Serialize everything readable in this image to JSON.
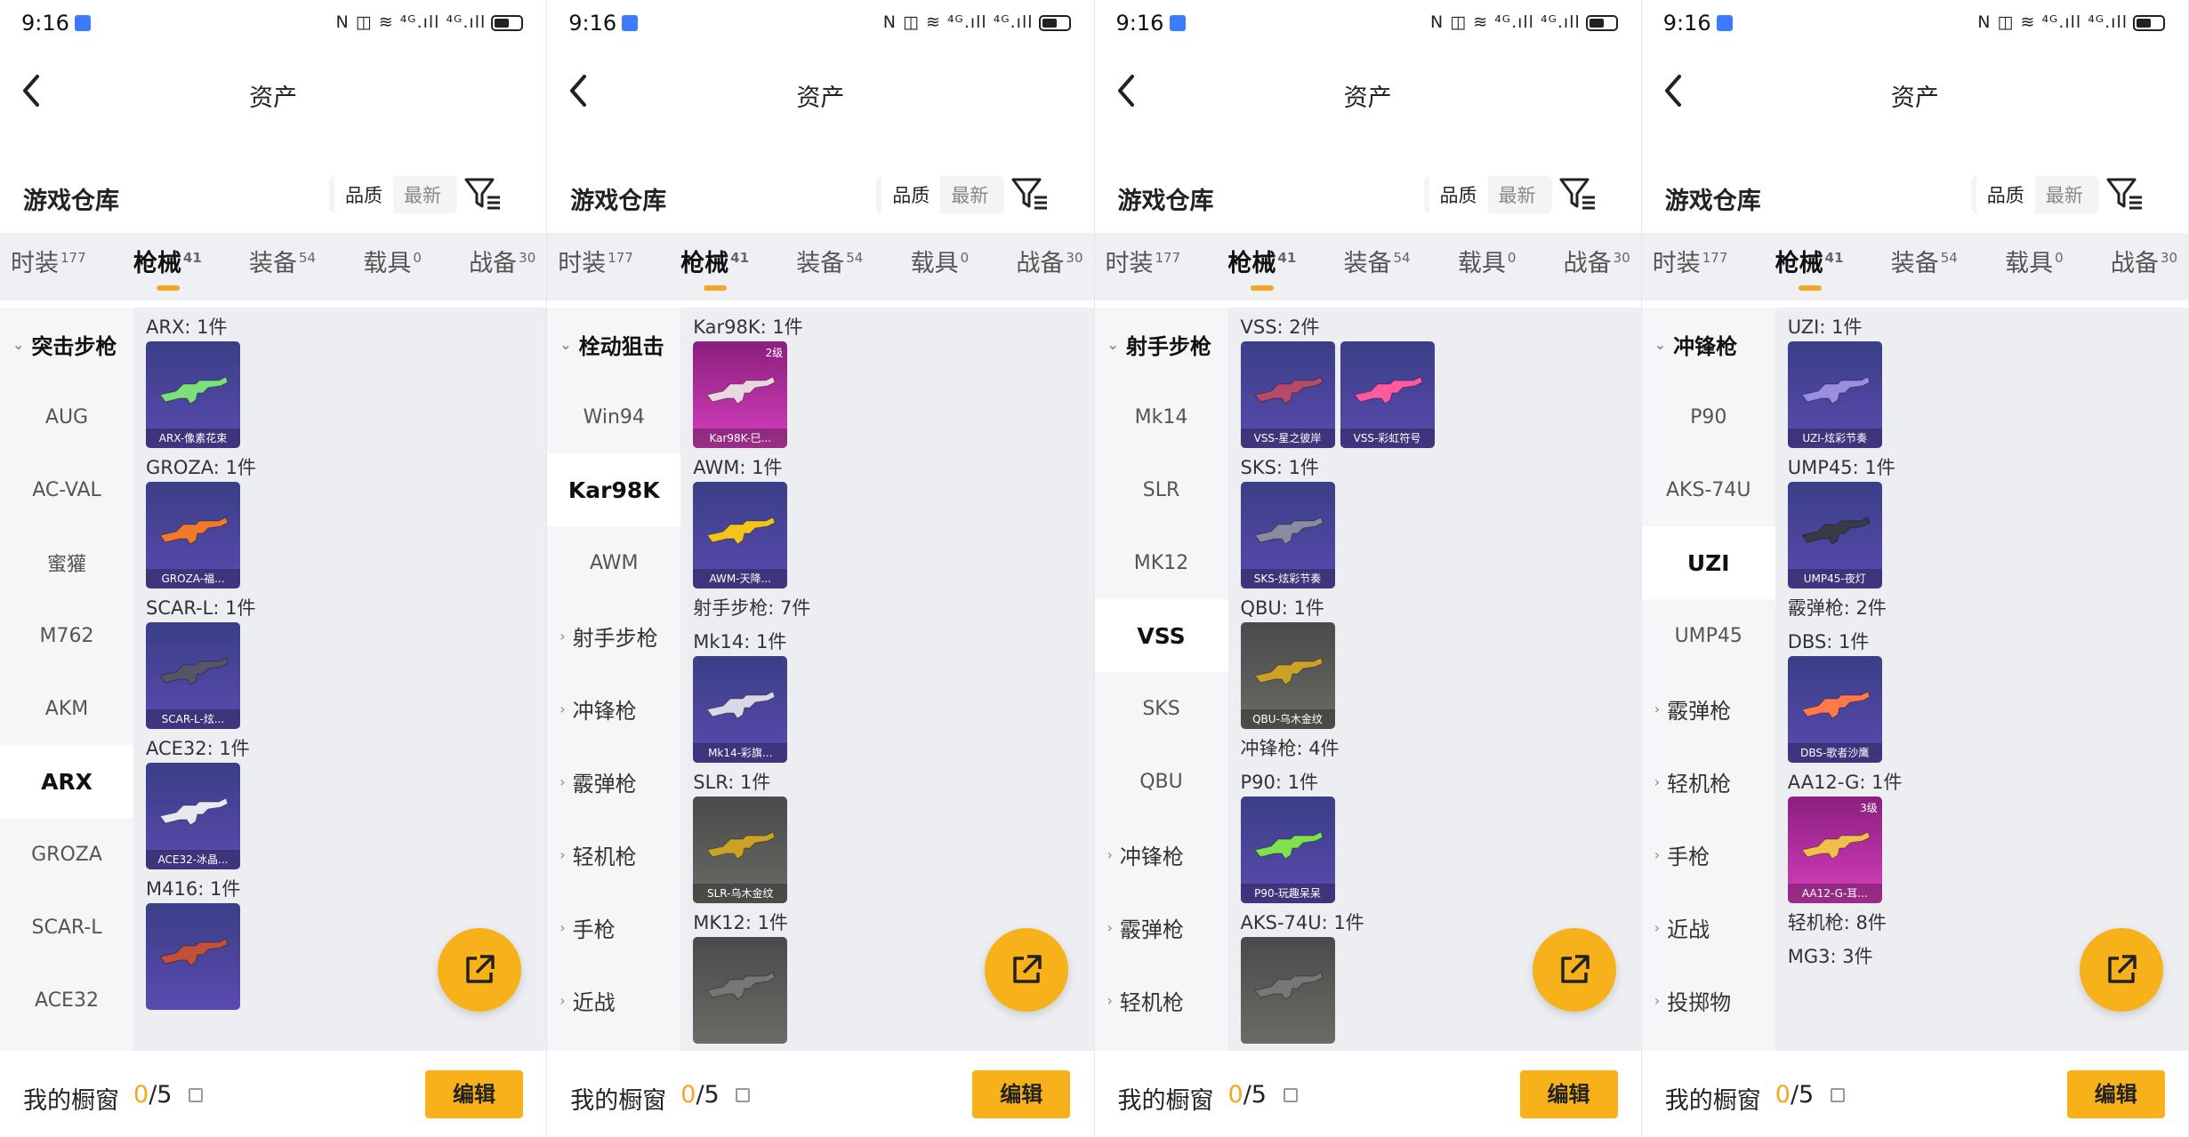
{
  "status": {
    "time": "9:16",
    "net": "N ◫ ≋ ⁴ᴳ.ıll ⁴ᴳ.ıll"
  },
  "nav": {
    "title": "资产"
  },
  "header": {
    "title": "游戏仓库",
    "sort_quality": "品质",
    "sort_latest": "最新"
  },
  "tabs": [
    {
      "label": "时装",
      "count": "177"
    },
    {
      "label": "枪械",
      "count": "41"
    },
    {
      "label": "装备",
      "count": "54"
    },
    {
      "label": "载具",
      "count": "0"
    },
    {
      "label": "战备",
      "count": "30"
    }
  ],
  "bottom": {
    "label": "我的橱窗",
    "current": "0",
    "total": "/5",
    "edit": "编辑"
  },
  "colors": {
    "accent": "#f7b21b",
    "tab_underline": "#f5a623"
  },
  "icons": [
    "back-arrow-icon",
    "filter-icon",
    "share-icon",
    "lock-icon",
    "chevron-icon"
  ],
  "panels": [
    {
      "sidebar": [
        {
          "label": "突击步枪",
          "type": "cat",
          "open": true
        },
        {
          "label": "AUG"
        },
        {
          "label": "AC-VAL"
        },
        {
          "label": "蜜獾"
        },
        {
          "label": "M762"
        },
        {
          "label": "AKM"
        },
        {
          "label": "ARX",
          "selected": true
        },
        {
          "label": "GROZA"
        },
        {
          "label": "SCAR-L"
        },
        {
          "label": "ACE32"
        }
      ],
      "groups": [
        {
          "label": "ARX: 1件",
          "cards": [
            {
              "name": "ARX-像素花束",
              "tone": "blue",
              "gun": "#7be07a"
            }
          ]
        },
        {
          "label": "GROZA: 1件",
          "cards": [
            {
              "name": "GROZA-福...",
              "tone": "blue",
              "gun": "#f07a2a"
            }
          ]
        },
        {
          "label": "SCAR-L: 1件",
          "cards": [
            {
              "name": "SCAR-L-炫...",
              "tone": "blue",
              "gun": "#555566"
            }
          ]
        },
        {
          "label": "ACE32: 1件",
          "cards": [
            {
              "name": "ACE32-冰晶...",
              "tone": "blue",
              "gun": "#e8e8f0"
            }
          ]
        },
        {
          "label": "M416: 1件",
          "cards": [
            {
              "name": "",
              "tone": "blue",
              "gun": "#c2503a"
            }
          ]
        }
      ]
    },
    {
      "sidebar": [
        {
          "label": "栓动狙击",
          "type": "cat",
          "open": true
        },
        {
          "label": "Win94"
        },
        {
          "label": "Kar98K",
          "selected": true
        },
        {
          "label": "AWM"
        },
        {
          "label": "射手步枪",
          "type": "cat"
        },
        {
          "label": "冲锋枪",
          "type": "cat"
        },
        {
          "label": "霰弹枪",
          "type": "cat"
        },
        {
          "label": "轻机枪",
          "type": "cat"
        },
        {
          "label": "手枪",
          "type": "cat"
        },
        {
          "label": "近战",
          "type": "cat"
        }
      ],
      "groups": [
        {
          "label": "Kar98K: 1件",
          "cards": [
            {
              "name": "Kar98K-巳...",
              "tone": "pink",
              "lvl": "2级",
              "gun": "#e9d8e0"
            }
          ]
        },
        {
          "label": "AWM: 1件",
          "cards": [
            {
              "name": "AWM-天降...",
              "tone": "blue",
              "gun": "#f2c41c"
            }
          ]
        },
        {
          "label": "射手步枪: 7件",
          "cards": []
        },
        {
          "label": "Mk14: 1件",
          "cards": [
            {
              "name": "Mk14-彩旗...",
              "tone": "blue",
              "gun": "#d8d8e8"
            }
          ]
        },
        {
          "label": "SLR: 1件",
          "cards": [
            {
              "name": "SLR-乌木金纹",
              "tone": "grey",
              "gun": "#c9a227"
            }
          ]
        },
        {
          "label": "MK12: 1件",
          "cards": [
            {
              "name": "",
              "tone": "grey",
              "gun": "#777"
            }
          ]
        }
      ]
    },
    {
      "sidebar": [
        {
          "label": "射手步枪",
          "type": "cat",
          "open": true
        },
        {
          "label": "Mk14"
        },
        {
          "label": "SLR"
        },
        {
          "label": "MK12"
        },
        {
          "label": "VSS",
          "selected": true
        },
        {
          "label": "SKS"
        },
        {
          "label": "QBU"
        },
        {
          "label": "冲锋枪",
          "type": "cat"
        },
        {
          "label": "霰弹枪",
          "type": "cat"
        },
        {
          "label": "轻机枪",
          "type": "cat"
        }
      ],
      "groups": [
        {
          "label": "VSS: 2件",
          "cards": [
            {
              "name": "VSS-星之彼岸",
              "tone": "blue",
              "gun": "#b64a6a"
            },
            {
              "name": "VSS-彩虹符号",
              "tone": "blue",
              "gun": "#ff5aa0"
            }
          ]
        },
        {
          "label": "SKS: 1件",
          "cards": [
            {
              "name": "SKS-炫彩节奏",
              "tone": "blue",
              "gun": "#8a8aa0"
            }
          ]
        },
        {
          "label": "QBU: 1件",
          "cards": [
            {
              "name": "QBU-乌木金纹",
              "tone": "grey",
              "gun": "#c9a227"
            }
          ]
        },
        {
          "label": "冲锋枪: 4件",
          "cards": []
        },
        {
          "label": "P90: 1件",
          "cards": [
            {
              "name": "P90-玩趣呆呆",
              "tone": "blue",
              "gun": "#7fe050"
            }
          ]
        },
        {
          "label": "AKS-74U: 1件",
          "cards": [
            {
              "name": "",
              "tone": "grey",
              "gun": "#777"
            }
          ]
        }
      ]
    },
    {
      "sidebar": [
        {
          "label": "冲锋枪",
          "type": "cat",
          "open": true
        },
        {
          "label": "P90"
        },
        {
          "label": "AKS-74U"
        },
        {
          "label": "UZI",
          "selected": true
        },
        {
          "label": "UMP45"
        },
        {
          "label": "霰弹枪",
          "type": "cat"
        },
        {
          "label": "轻机枪",
          "type": "cat"
        },
        {
          "label": "手枪",
          "type": "cat"
        },
        {
          "label": "近战",
          "type": "cat"
        },
        {
          "label": "投掷物",
          "type": "cat"
        }
      ],
      "groups": [
        {
          "label": "UZI: 1件",
          "cards": [
            {
              "name": "UZI-炫彩节奏",
              "tone": "blue",
              "gun": "#9a8ee0"
            }
          ]
        },
        {
          "label": "UMP45: 1件",
          "cards": [
            {
              "name": "UMP45-夜灯",
              "tone": "blue",
              "gun": "#3a3a44"
            }
          ]
        },
        {
          "label": "霰弹枪: 2件",
          "cards": []
        },
        {
          "label": "DBS: 1件",
          "cards": [
            {
              "name": "DBS-歌者沙鹰",
              "tone": "blue",
              "gun": "#ff7a4a"
            }
          ]
        },
        {
          "label": "AA12-G: 1件",
          "cards": [
            {
              "name": "AA12-G-耳...",
              "tone": "pink",
              "lvl": "3级",
              "gun": "#f0c04a"
            }
          ]
        },
        {
          "label": "轻机枪: 8件",
          "cards": []
        },
        {
          "label": "MG3: 3件",
          "cards": []
        }
      ]
    }
  ]
}
